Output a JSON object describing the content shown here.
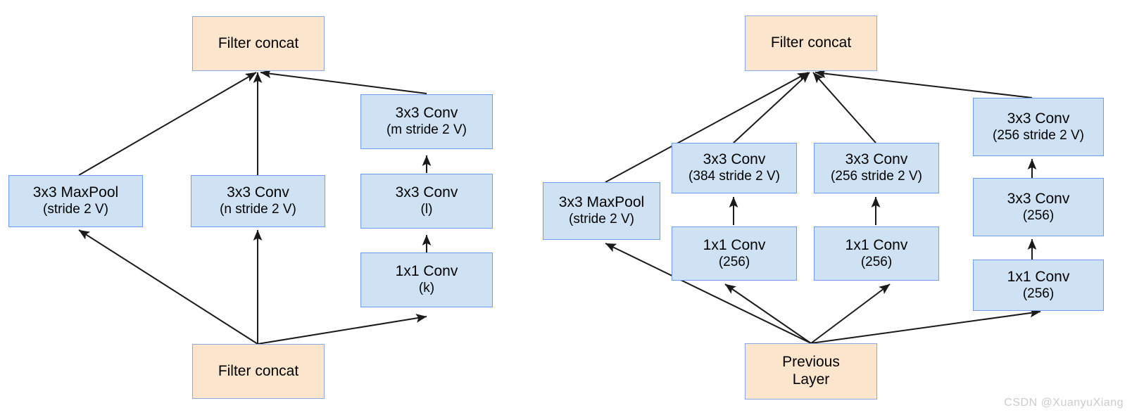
{
  "figure": {
    "background_color": "#ffffff",
    "block_fill_blue": "#cfe2f3",
    "block_border_blue": "#6d9eeb",
    "block_fill_peach": "#fce5cd",
    "edge_color": "#000000",
    "watermark": "CSDN @XuanyuXiang"
  },
  "left_diagram": {
    "name": "generic-grid-size-reduction-module",
    "nodes": {
      "top_concat": {
        "l1": "Filter concat",
        "l2": ""
      },
      "maxpool": {
        "l1": "3x3 MaxPool",
        "l2": "(stride 2 V)"
      },
      "conv_mid": {
        "l1": "3x3 Conv",
        "l2": "(n stride 2 V)"
      },
      "conv_r_top": {
        "l1": "3x3 Conv",
        "l2": "(m stride 2 V)"
      },
      "conv_r_mid": {
        "l1": "3x3 Conv",
        "l2": "(l)"
      },
      "conv_r_bot": {
        "l1": "1x1 Conv",
        "l2": "(k)"
      },
      "bottom_concat": {
        "l1": "Filter concat",
        "l2": ""
      }
    }
  },
  "right_diagram": {
    "name": "concrete-grid-size-reduction-module",
    "nodes": {
      "top_concat": {
        "l1": "Filter concat",
        "l2": ""
      },
      "maxpool": {
        "l1": "3x3 MaxPool",
        "l2": "(stride 2 V)"
      },
      "c1_top": {
        "l1": "3x3 Conv",
        "l2": "(384 stride 2 V)"
      },
      "c1_bot": {
        "l1": "1x1 Conv",
        "l2": "(256)"
      },
      "c2_top": {
        "l1": "3x3 Conv",
        "l2": "(256 stride 2 V)"
      },
      "c2_bot": {
        "l1": "1x1 Conv",
        "l2": "(256)"
      },
      "c3_top": {
        "l1": "3x3 Conv",
        "l2": "(256 stride 2 V)"
      },
      "c3_mid": {
        "l1": "3x3 Conv",
        "l2": "(256)"
      },
      "c3_bot": {
        "l1": "1x1 Conv",
        "l2": "(256)"
      },
      "previous_layer": {
        "l1": "Previous",
        "l2": "Layer"
      }
    }
  }
}
